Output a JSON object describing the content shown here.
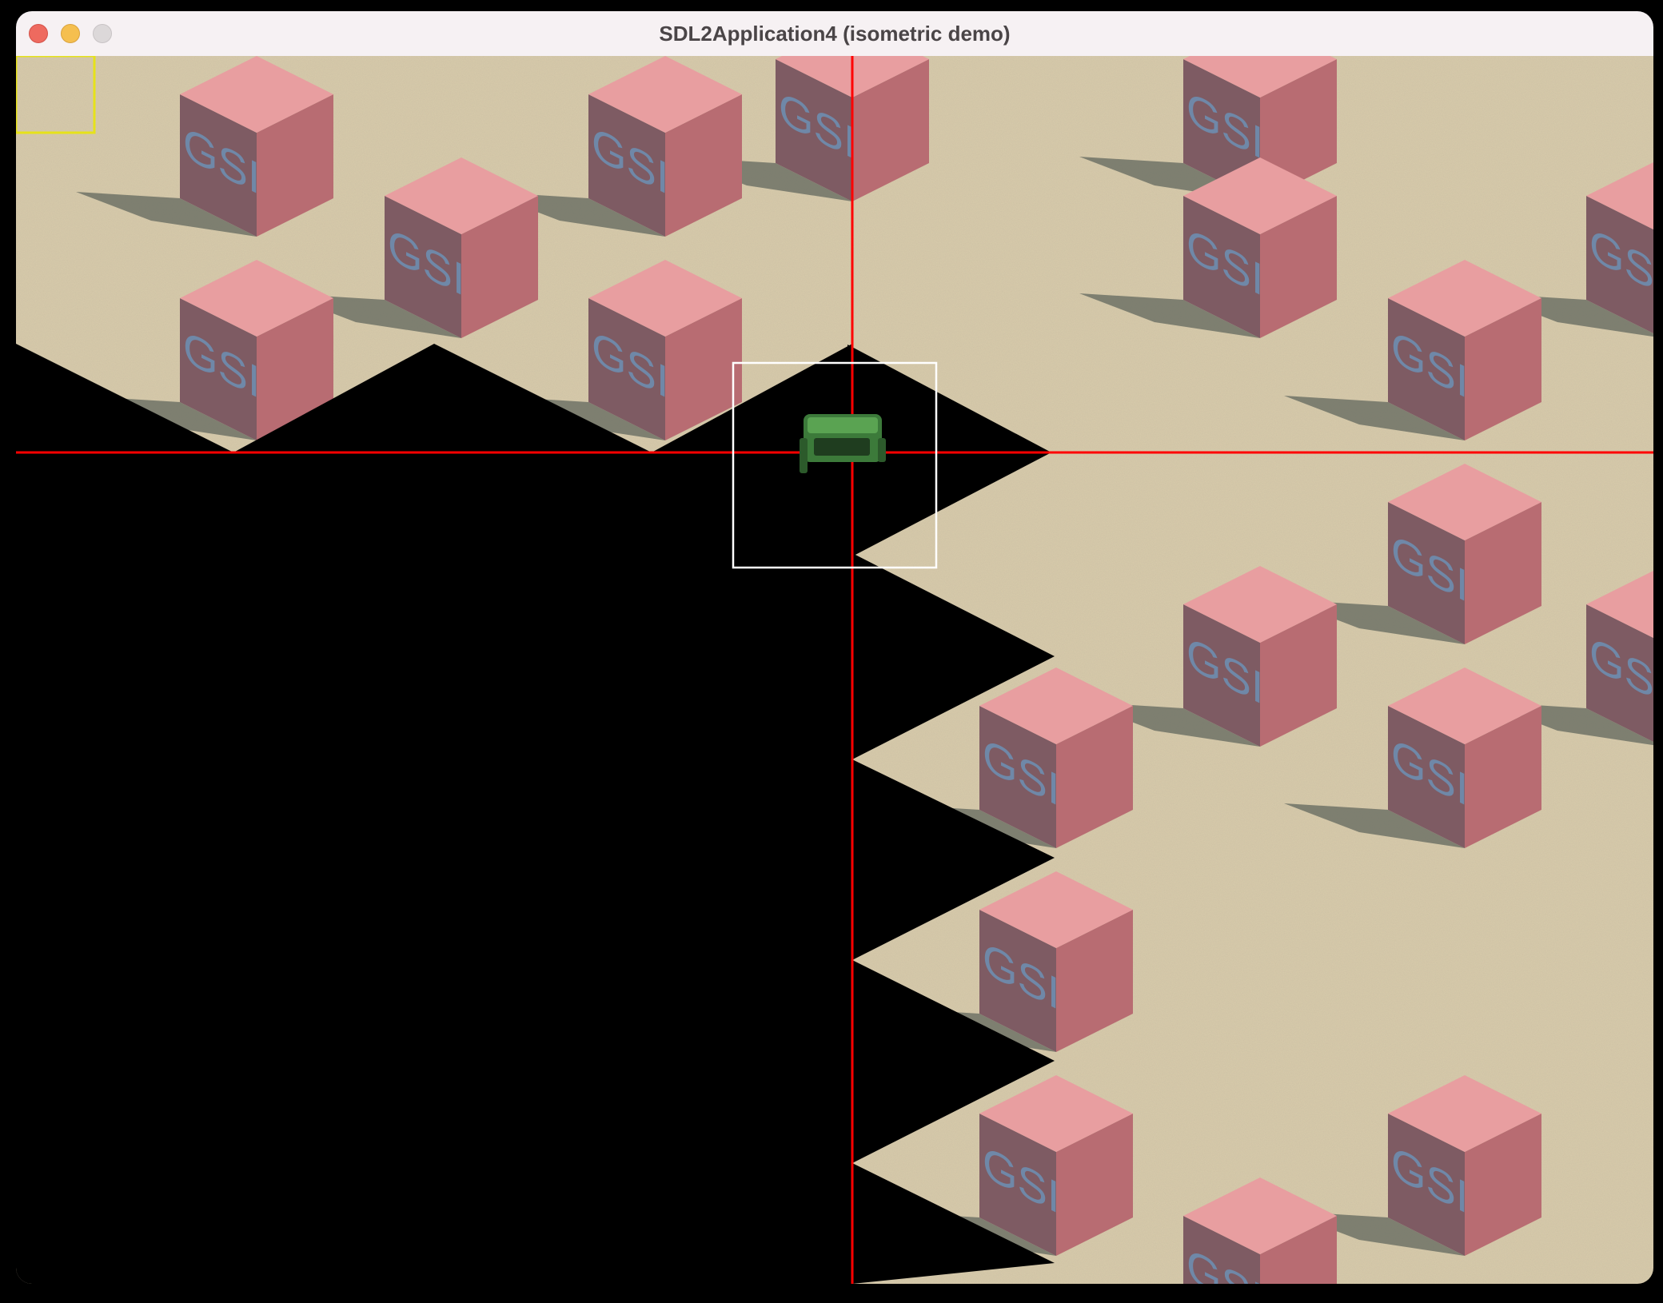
{
  "window": {
    "title": "SDL2Application4 (isometric demo)"
  },
  "scene": {
    "ground_color": "#d8cbab",
    "void_color": "#000000",
    "crosshair_color": "#ff0000",
    "cube_top_color": "#e89ea0",
    "cube_left_color": "#7e5b63",
    "cube_right_color": "#b86c72",
    "cube_shadow_color": "#6f7266",
    "cube_label": "GSI",
    "cube_label_color": "#6f88a8",
    "selection_box_color": "#ffffff",
    "minimap_box_color": "#e6e21a",
    "player_color": "#3c7a3a",
    "player_icon": "green-vehicle-icon"
  }
}
